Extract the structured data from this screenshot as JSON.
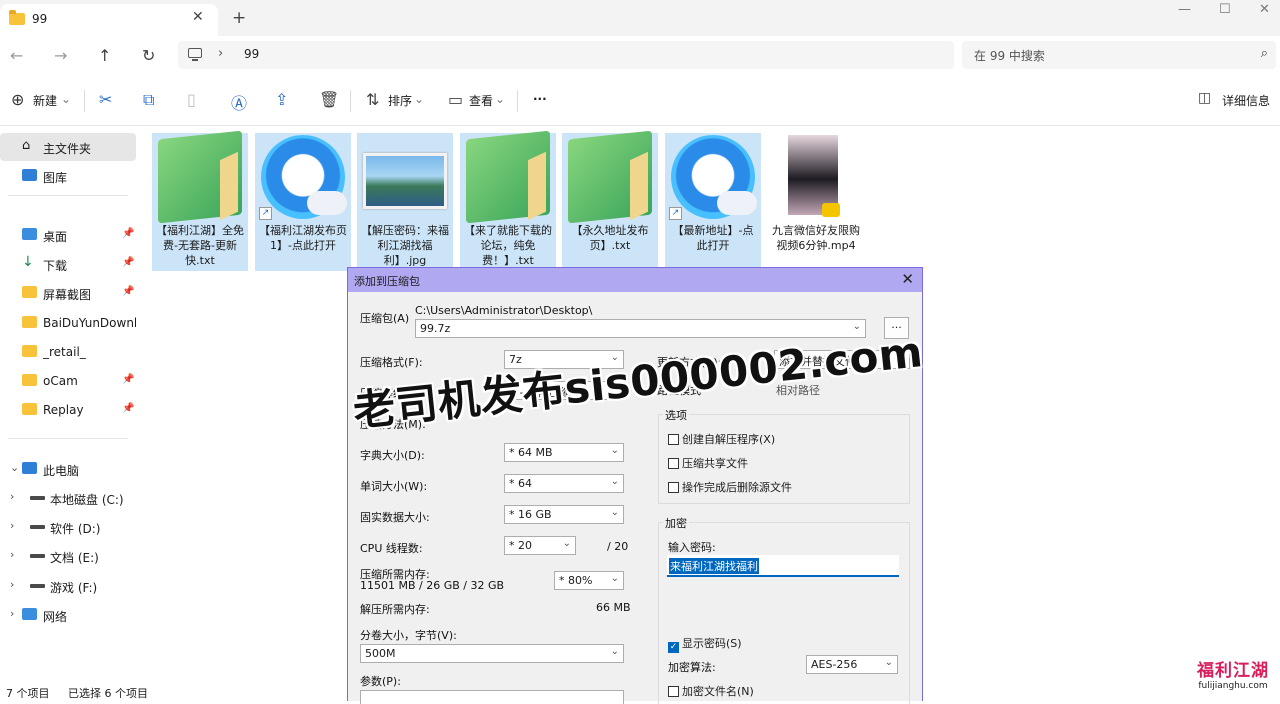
{
  "window": {
    "tab_title": "99",
    "tab_close": "✕",
    "new_tab": "+",
    "minimize": "—",
    "maximize": "☐",
    "close": "✕"
  },
  "address": {
    "breadcrumb_sep": "›",
    "crumb": "99",
    "search_placeholder": "在 99 中搜索"
  },
  "toolbar": {
    "new_label": "新建",
    "sort_label": "排序",
    "view_label": "查看",
    "more_label": "···",
    "details_label": "详细信息"
  },
  "sidebar": {
    "home": "主文件夹",
    "gallery": "图库",
    "quick": [
      {
        "label": "桌面",
        "pinned": true
      },
      {
        "label": "下载",
        "pinned": true
      },
      {
        "label": "屏幕截图",
        "pinned": true
      },
      {
        "label": "BaiDuYunDownload",
        "pinned": false
      },
      {
        "label": "_retail_",
        "pinned": false
      },
      {
        "label": "oCam",
        "pinned": true
      },
      {
        "label": "Replay",
        "pinned": true
      }
    ],
    "this_pc": "此电脑",
    "drives": [
      "本地磁盘 (C:)",
      "软件 (D:)",
      "文档 (E:)",
      "游戏 (F:)"
    ],
    "network": "网络"
  },
  "files": [
    {
      "name": "【福利江湖】全免费-无套路-更新快.txt",
      "kind": "notepad"
    },
    {
      "name": "【福利江湖发布页1】-点此打开",
      "kind": "qq-shortcut"
    },
    {
      "name": "【解压密码：来福利江湖找福利】.jpg",
      "kind": "photo"
    },
    {
      "name": "【来了就能下载的论坛，纯免费！】.txt",
      "kind": "notepad"
    },
    {
      "name": "【永久地址发布页】.txt",
      "kind": "notepad"
    },
    {
      "name": "【最新地址】-点此打开",
      "kind": "qq-shortcut"
    },
    {
      "name": "九言微信好友限购视频6分钟.mp4",
      "kind": "video"
    }
  ],
  "status": {
    "count": "7 个项目",
    "selected": "已选择 6 个项目"
  },
  "dialog": {
    "title": "添加到压缩包",
    "archive_label": "压缩包(A)",
    "archive_path": "C:\\Users\\Administrator\\Desktop\\",
    "archive_name": "99.7z",
    "browse": "...",
    "format_label": "压缩格式(F):",
    "format_value": "7z",
    "level_label": "压缩等级(L):",
    "level_value": "9 - 极限压缩",
    "method_label": "压缩方法(M):",
    "dict_label": "字典大小(D):",
    "dict_value": "* 64 MB",
    "word_label": "单词大小(W):",
    "word_value": "* 64",
    "solid_label": "固实数据大小:",
    "solid_value": "* 16 GB",
    "threads_label": "CPU 线程数:",
    "threads_value": "* 20",
    "threads_total": "/ 20",
    "mem_label": "压缩所需内存:",
    "mem_detail": "11501 MB / 26 GB / 32 GB",
    "mem_percent": "* 80%",
    "demem_label": "解压所需内存:",
    "demem_value": "66 MB",
    "volume_label": "分卷大小，字节(V):",
    "volume_value": "500M",
    "params_label": "参数(P):",
    "update_label": "更新方式(U):",
    "update_value": "添加并替换文件",
    "path_label": "路径模式",
    "path_value": "相对路径",
    "options_label": "选项",
    "opt_sfx": "创建自解压程序(X)",
    "opt_shared": "压缩共享文件",
    "opt_delete": "操作完成后删除源文件",
    "encrypt_label": "加密",
    "password_label": "输入密码:",
    "password_value": "来福利江湖找福利",
    "show_password": "显示密码(S)",
    "enc_method_label": "加密算法:",
    "enc_method_value": "AES-256",
    "enc_names": "加密文件名(N)"
  },
  "overlay": {
    "watermark": "老司机发布sis000002.com",
    "logo_big": "福利江湖",
    "logo_small": "fulijianghu.com"
  },
  "colors": {
    "selection": "#cce4f7",
    "dialog_title": "#b0a8f0",
    "accent": "#0067c0"
  }
}
